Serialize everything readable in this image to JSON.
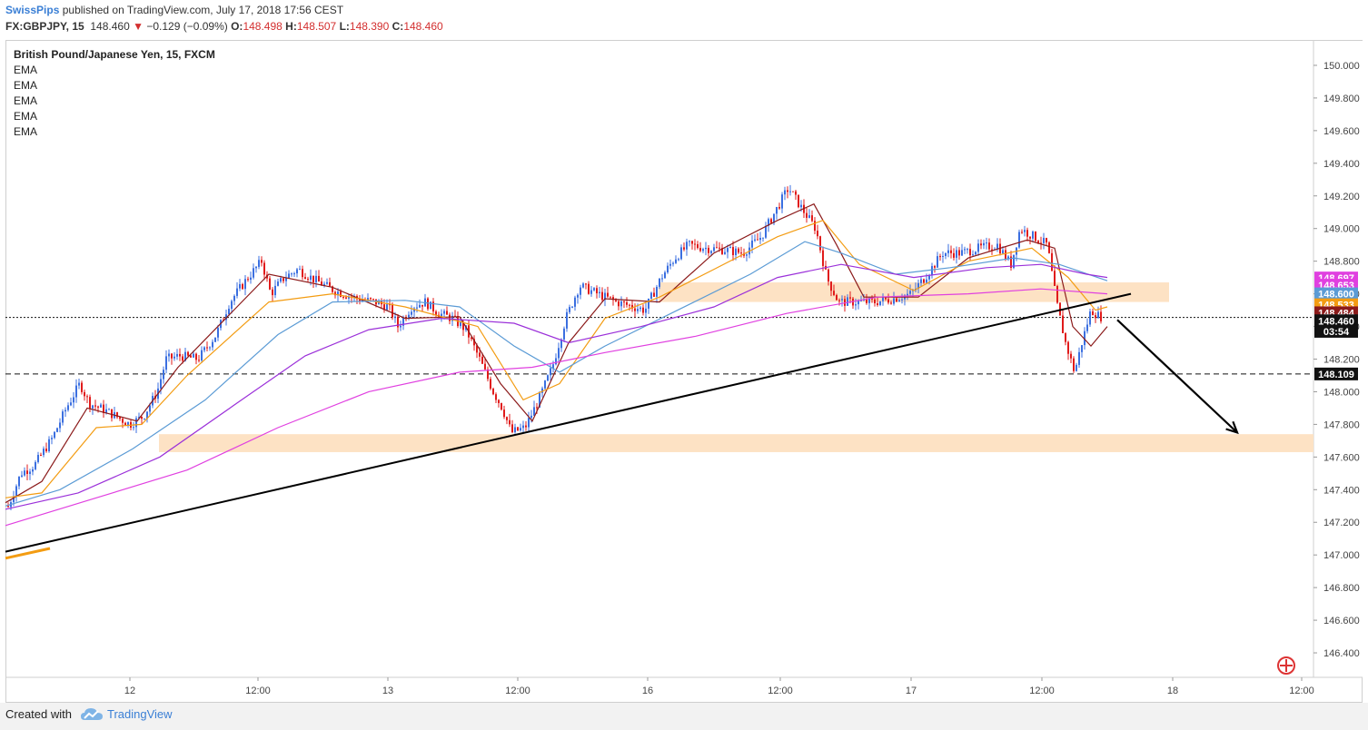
{
  "header": {
    "author": "SwissPips",
    "published_text": "published on TradingView.com, July 17, 2018 17:56 CEST",
    "symbol": "FX:GBPJPY, 15",
    "last": "148.460",
    "change": "−0.129 (−0.09%)",
    "open_label": "O:",
    "open": "148.498",
    "high_label": "H:",
    "high": "148.507",
    "low_label": "L:",
    "low": "148.390",
    "close_label": "C:",
    "close": "148.460"
  },
  "legend": {
    "title": "British Pound/Japanese Yen, 15, FXCM",
    "indicators": [
      "EMA",
      "EMA",
      "EMA",
      "EMA",
      "EMA"
    ]
  },
  "footer": {
    "created_with": "Created with",
    "brand": "TradingView"
  },
  "colors": {
    "up_candle": "#3b6fe0",
    "down_candle": "#e01b1b",
    "ema_fast": "#8b1a1a",
    "ema_2": "#f39c12",
    "ema_3": "#5b9bd5",
    "ema_4": "#9b30d9",
    "ema_5": "#e040e0",
    "zone": "#fde2c4",
    "trendline": "#000000"
  },
  "chart_data": {
    "type": "candlestick",
    "title": "British Pound/Japanese Yen, 15, FXCM",
    "ylim": [
      146.25,
      150.15
    ],
    "y_ticks": [
      "150.000",
      "149.800",
      "149.600",
      "149.400",
      "149.200",
      "149.000",
      "148.800",
      "148.600",
      "148.400",
      "148.200",
      "148.000",
      "147.800",
      "147.600",
      "147.400",
      "147.200",
      "147.000",
      "146.800",
      "146.600",
      "146.400"
    ],
    "x_ticks": [
      "12",
      "12:00",
      "13",
      "12:00",
      "16",
      "12:00",
      "17",
      "12:00",
      "18",
      "12:00"
    ],
    "price_path": [
      [
        0,
        147.3
      ],
      [
        10,
        147.28
      ],
      [
        25,
        147.5
      ],
      [
        40,
        147.55
      ],
      [
        60,
        147.72
      ],
      [
        75,
        147.9
      ],
      [
        90,
        148.05
      ],
      [
        100,
        147.93
      ],
      [
        120,
        147.88
      ],
      [
        145,
        147.8
      ],
      [
        160,
        147.85
      ],
      [
        175,
        148.0
      ],
      [
        185,
        148.2
      ],
      [
        200,
        148.22
      ],
      [
        220,
        148.2
      ],
      [
        240,
        148.35
      ],
      [
        255,
        148.55
      ],
      [
        275,
        148.7
      ],
      [
        290,
        148.8
      ],
      [
        300,
        148.6
      ],
      [
        315,
        148.7
      ],
      [
        330,
        148.75
      ],
      [
        350,
        148.68
      ],
      [
        370,
        148.62
      ],
      [
        395,
        148.57
      ],
      [
        415,
        148.55
      ],
      [
        430,
        148.52
      ],
      [
        440,
        148.4
      ],
      [
        455,
        148.52
      ],
      [
        470,
        148.55
      ],
      [
        485,
        148.48
      ],
      [
        500,
        148.45
      ],
      [
        515,
        148.38
      ],
      [
        530,
        148.2
      ],
      [
        545,
        148.0
      ],
      [
        555,
        147.9
      ],
      [
        565,
        147.75
      ],
      [
        580,
        147.78
      ],
      [
        595,
        147.95
      ],
      [
        610,
        148.15
      ],
      [
        625,
        148.45
      ],
      [
        640,
        148.65
      ],
      [
        660,
        148.6
      ],
      [
        680,
        148.55
      ],
      [
        700,
        148.52
      ],
      [
        712,
        148.5
      ],
      [
        730,
        148.7
      ],
      [
        745,
        148.82
      ],
      [
        760,
        148.9
      ],
      [
        780,
        148.88
      ],
      [
        800,
        148.87
      ],
      [
        820,
        148.85
      ],
      [
        840,
        148.95
      ],
      [
        855,
        149.1
      ],
      [
        870,
        149.25
      ],
      [
        885,
        149.12
      ],
      [
        900,
        149.0
      ],
      [
        912,
        148.7
      ],
      [
        925,
        148.55
      ],
      [
        945,
        148.55
      ],
      [
        965,
        148.55
      ],
      [
        985,
        148.57
      ],
      [
        1005,
        148.6
      ],
      [
        1020,
        148.7
      ],
      [
        1040,
        148.85
      ],
      [
        1060,
        148.85
      ],
      [
        1080,
        148.88
      ],
      [
        1100,
        148.9
      ],
      [
        1115,
        148.78
      ],
      [
        1125,
        149.0
      ],
      [
        1140,
        148.95
      ],
      [
        1155,
        148.9
      ],
      [
        1165,
        148.55
      ],
      [
        1175,
        148.3
      ],
      [
        1185,
        148.12
      ],
      [
        1193,
        148.3
      ],
      [
        1203,
        148.5
      ],
      [
        1213,
        148.46
      ]
    ],
    "ema_lines": [
      {
        "values": [
          [
            0,
            147.32
          ],
          [
            40,
            147.45
          ],
          [
            90,
            147.9
          ],
          [
            145,
            147.82
          ],
          [
            190,
            148.15
          ],
          [
            290,
            148.72
          ],
          [
            360,
            148.64
          ],
          [
            440,
            148.45
          ],
          [
            500,
            148.46
          ],
          [
            545,
            148.05
          ],
          [
            580,
            147.82
          ],
          [
            620,
            148.3
          ],
          [
            660,
            148.57
          ],
          [
            720,
            148.55
          ],
          [
            780,
            148.85
          ],
          [
            850,
            149.05
          ],
          [
            890,
            149.15
          ],
          [
            915,
            148.9
          ],
          [
            945,
            148.58
          ],
          [
            1005,
            148.58
          ],
          [
            1060,
            148.82
          ],
          [
            1125,
            148.93
          ],
          [
            1155,
            148.88
          ],
          [
            1175,
            148.4
          ],
          [
            1195,
            148.28
          ],
          [
            1213,
            148.4
          ]
        ]
      },
      {
        "values": [
          [
            0,
            147.35
          ],
          [
            40,
            147.38
          ],
          [
            100,
            147.78
          ],
          [
            150,
            147.8
          ],
          [
            200,
            148.1
          ],
          [
            290,
            148.55
          ],
          [
            360,
            148.6
          ],
          [
            440,
            148.52
          ],
          [
            520,
            148.4
          ],
          [
            570,
            147.95
          ],
          [
            610,
            148.05
          ],
          [
            660,
            148.45
          ],
          [
            720,
            148.58
          ],
          [
            780,
            148.75
          ],
          [
            850,
            148.95
          ],
          [
            900,
            149.05
          ],
          [
            940,
            148.78
          ],
          [
            1000,
            148.62
          ],
          [
            1060,
            148.8
          ],
          [
            1130,
            148.88
          ],
          [
            1170,
            148.7
          ],
          [
            1200,
            148.5
          ],
          [
            1213,
            148.52
          ]
        ]
      },
      {
        "values": [
          [
            0,
            147.3
          ],
          [
            60,
            147.4
          ],
          [
            140,
            147.65
          ],
          [
            220,
            147.95
          ],
          [
            300,
            148.35
          ],
          [
            360,
            148.55
          ],
          [
            440,
            148.56
          ],
          [
            500,
            148.52
          ],
          [
            560,
            148.28
          ],
          [
            610,
            148.12
          ],
          [
            660,
            148.28
          ],
          [
            740,
            148.5
          ],
          [
            820,
            148.72
          ],
          [
            880,
            148.92
          ],
          [
            920,
            148.85
          ],
          [
            980,
            148.72
          ],
          [
            1040,
            148.76
          ],
          [
            1110,
            148.82
          ],
          [
            1160,
            148.78
          ],
          [
            1213,
            148.68
          ]
        ]
      },
      {
        "values": [
          [
            0,
            147.28
          ],
          [
            80,
            147.38
          ],
          [
            170,
            147.6
          ],
          [
            260,
            147.95
          ],
          [
            330,
            148.22
          ],
          [
            400,
            148.38
          ],
          [
            480,
            148.45
          ],
          [
            560,
            148.42
          ],
          [
            620,
            148.3
          ],
          [
            700,
            148.4
          ],
          [
            780,
            148.52
          ],
          [
            850,
            148.7
          ],
          [
            920,
            148.78
          ],
          [
            1000,
            148.7
          ],
          [
            1080,
            148.76
          ],
          [
            1140,
            148.78
          ],
          [
            1190,
            148.72
          ],
          [
            1213,
            148.7
          ]
        ]
      },
      {
        "values": [
          [
            0,
            147.18
          ],
          [
            100,
            147.35
          ],
          [
            200,
            147.52
          ],
          [
            300,
            147.78
          ],
          [
            400,
            148.0
          ],
          [
            500,
            148.12
          ],
          [
            580,
            148.15
          ],
          [
            660,
            148.24
          ],
          [
            760,
            148.34
          ],
          [
            860,
            148.48
          ],
          [
            960,
            148.58
          ],
          [
            1060,
            148.6
          ],
          [
            1140,
            148.63
          ],
          [
            1213,
            148.6
          ]
        ]
      }
    ],
    "horizontal_lines": [
      {
        "price": 148.455,
        "style": "dotted"
      },
      {
        "price": 148.109,
        "style": "dashed"
      }
    ],
    "zones": [
      {
        "x1": 725,
        "x2": 1287,
        "y1": 148.67,
        "y2": 148.55
      },
      {
        "x1": 175,
        "x2": 1446,
        "y1": 147.74,
        "y2": 147.63
      }
    ],
    "trendline": {
      "x1": 6,
      "y1": 147.02,
      "x2": 1245,
      "y2": 148.6
    },
    "orange_segment": {
      "x1": 6,
      "y1": 146.98,
      "x2": 55,
      "y2": 147.04
    },
    "arrow": {
      "x1": 1230,
      "y1": 148.44,
      "x2": 1362,
      "y2": 147.75
    },
    "price_labels": [
      {
        "text": "148.697",
        "price": 148.697,
        "bg": "#e040e0",
        "color": "#ffffff"
      },
      {
        "text": "148.653",
        "price": 148.653,
        "bg": "#e040e0",
        "color": "#ffffff"
      },
      {
        "text": "148.600",
        "price": 148.6,
        "bg": "#5b9bd5",
        "color": "#ffffff"
      },
      {
        "text": "148.533",
        "price": 148.533,
        "bg": "#f39c12",
        "color": "#ffffff"
      },
      {
        "text": "148.484",
        "price": 148.484,
        "bg": "#8b1a1a",
        "color": "#ffffff"
      },
      {
        "text": "148.460",
        "price": 148.435,
        "bg": "#111111",
        "color": "#ffffff"
      },
      {
        "text": "03:54",
        "price": 148.37,
        "bg": "#111111",
        "color": "#ffffff"
      },
      {
        "text": "148.109",
        "price": 148.109,
        "bg": "#111111",
        "color": "#ffffff"
      }
    ]
  }
}
